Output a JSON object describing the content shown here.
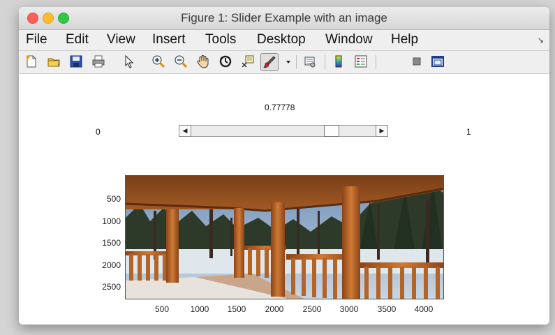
{
  "window": {
    "title": "Figure 1: Slider Example with an image"
  },
  "menu": [
    "File",
    "Edit",
    "View",
    "Insert",
    "Tools",
    "Desktop",
    "Window",
    "Help"
  ],
  "toolbar": [
    "new-figure-icon",
    "open-file-icon",
    "save-icon",
    "print-icon",
    "pointer-icon",
    "zoom-in-icon",
    "zoom-out-icon",
    "pan-hand-icon",
    "rotate-3d-icon",
    "data-cursor-icon",
    "brush-icon",
    "dropdown-arrow-icon",
    "link-plot-icon",
    "colorbar-icon",
    "legend-icon",
    "hide-plot-tools-icon",
    "show-plot-tools-icon"
  ],
  "slider": {
    "value_text": "0.77778",
    "min_label": "0",
    "max_label": "1",
    "value": 0.77778
  },
  "image_axes": {
    "yticks": [
      "500",
      "1000",
      "1500",
      "2000",
      "2500"
    ],
    "xticks": [
      "500",
      "1000",
      "1500",
      "2000",
      "2500",
      "3000",
      "3500",
      "4000"
    ]
  }
}
